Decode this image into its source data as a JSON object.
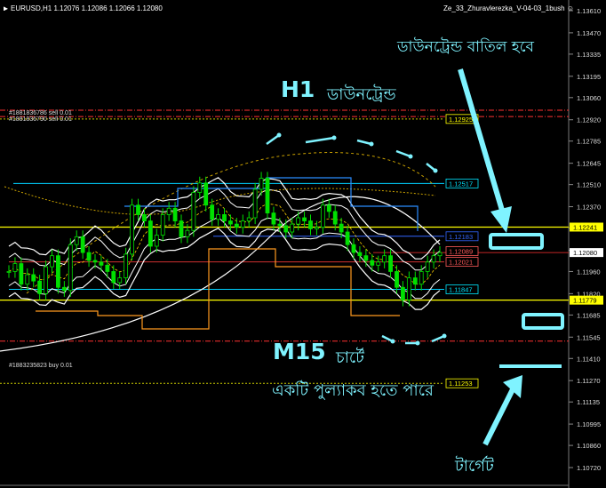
{
  "header": {
    "symbol_info": "EURUSD,H1  1.12076 1.12086 1.12066 1.12080",
    "ea_name": "Ze_33_Zhuravlerezka_V-04-03_1bush"
  },
  "annotations": {
    "cancel_text": "ডাউনট্রেন্ড বাতিল হবে",
    "h1_label": "H1",
    "h1_text": "ডাউনট্রেন্ড",
    "m15_label": "M15",
    "m15_text": "চার্টে",
    "pullback_text": "একটি  পুল্যাকব হতে পারে",
    "target_text": "টার্গেট"
  },
  "orders": {
    "top1": "#1881836786 sell 0.01",
    "top2": "#1881836790 sell 0.01",
    "bottom": "#1883235823 buy 0.01"
  },
  "colors": {
    "background": "#000000",
    "annotation": "#7ff3ff",
    "candle": "#00e000",
    "bollinger": "#ffffff",
    "level_yellow": "#ffff00",
    "level_cyan": "#3399ff",
    "level_orange": "#ff9a1f",
    "level_red": "#ff3030"
  },
  "chart_data": {
    "type": "line",
    "symbol": "EURUSD",
    "timeframe": "H1",
    "ohlc": {
      "open": 1.12076,
      "high": 1.12086,
      "low": 1.12066,
      "close": 1.1208
    },
    "current_price": 1.1208,
    "ylim": [
      1.1082,
      1.137
    ],
    "y_ticks": [
      "1.13610",
      "1.13335",
      "1.13060",
      "1.12785",
      "1.12510",
      "1.12235",
      "1.11960",
      "1.11685",
      "1.11410",
      "1.11135",
      "1.10860",
      "1.13470",
      "1.13195",
      "1.12920",
      "1.12645",
      "1.12370",
      "1.12095",
      "1.11820",
      "1.11545",
      "1.11270",
      "1.10995",
      "1.10720"
    ],
    "y_tick_values": [
      1.1361,
      1.13335,
      1.1306,
      1.12785,
      1.1251,
      1.12235,
      1.1196,
      1.11685,
      1.1141,
      1.11135,
      1.1086,
      1.1347,
      1.13195,
      1.1292,
      1.12645,
      1.1237,
      1.12095,
      1.1182,
      1.11545,
      1.1127,
      1.10995,
      1.1072
    ],
    "price_labels": [
      {
        "text": "1.12241",
        "value": 1.12241,
        "color": "#ffff00"
      },
      {
        "text": "1.12080",
        "value": 1.1208,
        "color": "#ffffff"
      },
      {
        "text": "1.11779",
        "value": 1.11779,
        "color": "#ffff00"
      }
    ],
    "level_boxes": [
      {
        "text": "1.12925",
        "value": 1.12925,
        "color": "#ffff00"
      },
      {
        "text": "1.12517",
        "value": 1.12517,
        "color": "#00e5ff"
      },
      {
        "text": "1.12183",
        "value": 1.12183,
        "color": "#3366ff"
      },
      {
        "text": "1.12089",
        "value": 1.12089,
        "color": "#ff5a5a"
      },
      {
        "text": "1.12021",
        "value": 1.12021,
        "color": "#ff5a5a"
      },
      {
        "text": "1.11847",
        "value": 1.11847,
        "color": "#00e5ff"
      },
      {
        "text": "1.11253",
        "value": 1.11253,
        "color": "#ffff00"
      }
    ],
    "horizontal_levels": [
      {
        "value": 1.12241,
        "color": "#ffff00",
        "style": "solid"
      },
      {
        "value": 1.11779,
        "color": "#ffff00",
        "style": "solid"
      },
      {
        "value": 1.1298,
        "color": "#ff3030",
        "style": "dashdot"
      },
      {
        "value": 1.1294,
        "color": "#ff3030",
        "style": "dashdot"
      },
      {
        "value": 1.1152,
        "color": "#ff3030",
        "style": "dashdot"
      },
      {
        "value": 1.1208,
        "color": "#ff3030",
        "style": "solid"
      }
    ],
    "price_series": [
      1.1196,
      1.1201,
      1.1188,
      1.1194,
      1.119,
      1.1182,
      1.1199,
      1.1206,
      1.1186,
      1.1184,
      1.1213,
      1.1218,
      1.1208,
      1.1203,
      1.1202,
      1.12,
      1.1196,
      1.1189,
      1.1192,
      1.1207,
      1.1238,
      1.1232,
      1.1228,
      1.1212,
      1.1219,
      1.1232,
      1.1236,
      1.1228,
      1.1218,
      1.1222,
      1.1246,
      1.1252,
      1.1238,
      1.1229,
      1.1232,
      1.1228,
      1.1226,
      1.1224,
      1.1228,
      1.123,
      1.1248,
      1.1255,
      1.1233,
      1.1226,
      1.1225,
      1.1221,
      1.1226,
      1.123,
      1.1228,
      1.1223,
      1.1224,
      1.1238,
      1.1234,
      1.1226,
      1.1221,
      1.1213,
      1.1208,
      1.1206,
      1.1203,
      1.12,
      1.1202,
      1.1206,
      1.1196,
      1.1186,
      1.1178,
      1.1192,
      1.1188,
      1.1196,
      1.1202,
      1.1206,
      1.1208
    ],
    "grid": false,
    "legend": "none"
  }
}
